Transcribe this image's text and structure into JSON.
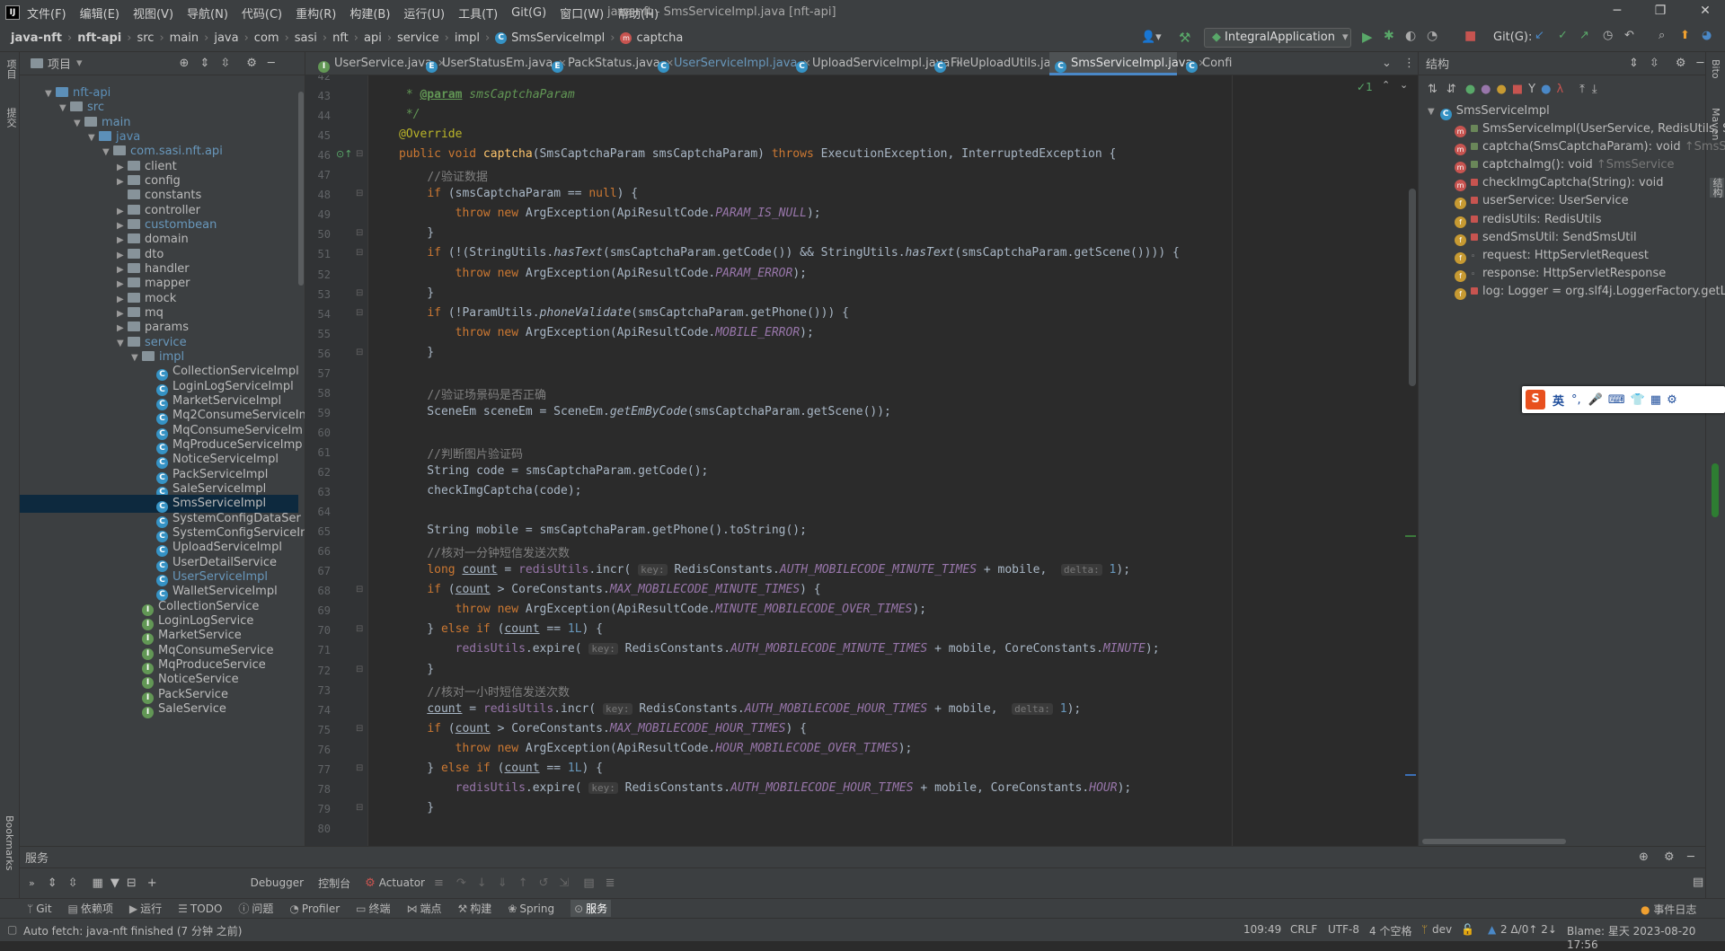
{
  "titlebar": {
    "menu": [
      "文件(F)",
      "编辑(E)",
      "视图(V)",
      "导航(N)",
      "代码(C)",
      "重构(R)",
      "构建(B)",
      "运行(U)",
      "工具(T)",
      "Git(G)",
      "窗口(W)",
      "帮助(H)"
    ],
    "window_title": "java-nft - SmsServiceImpl.java [nft-api]"
  },
  "navbar": {
    "crumbs": [
      "java-nft",
      "nft-api",
      "src",
      "main",
      "java",
      "com",
      "sasi",
      "nft",
      "api",
      "service",
      "impl",
      "SmsServiceImpl",
      "captcha"
    ],
    "run_config": "IntegralApplication",
    "git_label": "Git(G):"
  },
  "project": {
    "title": "项目",
    "items": [
      {
        "label": "nft-api",
        "kind": "module",
        "depth": 1,
        "expanded": true
      },
      {
        "label": "src",
        "kind": "folder",
        "depth": 2,
        "expanded": true
      },
      {
        "label": "main",
        "kind": "folder",
        "depth": 3,
        "expanded": true
      },
      {
        "label": "java",
        "kind": "folder-blue",
        "depth": 4,
        "expanded": true
      },
      {
        "label": "com.sasi.nft.api",
        "kind": "package",
        "depth": 5,
        "expanded": true
      },
      {
        "label": "client",
        "kind": "package",
        "depth": 6,
        "expanded": false
      },
      {
        "label": "config",
        "kind": "package",
        "depth": 6,
        "expanded": false
      },
      {
        "label": "constants",
        "kind": "package",
        "depth": 6,
        "expanded": null
      },
      {
        "label": "controller",
        "kind": "package",
        "depth": 6,
        "expanded": false
      },
      {
        "label": "custombean",
        "kind": "package",
        "depth": 6,
        "expanded": false
      },
      {
        "label": "domain",
        "kind": "package",
        "depth": 6,
        "expanded": false
      },
      {
        "label": "dto",
        "kind": "package",
        "depth": 6,
        "expanded": false
      },
      {
        "label": "handler",
        "kind": "package",
        "depth": 6,
        "expanded": false
      },
      {
        "label": "mapper",
        "kind": "package",
        "depth": 6,
        "expanded": false
      },
      {
        "label": "mock",
        "kind": "package",
        "depth": 6,
        "expanded": false
      },
      {
        "label": "mq",
        "kind": "package",
        "depth": 6,
        "expanded": false
      },
      {
        "label": "params",
        "kind": "package",
        "depth": 6,
        "expanded": false
      },
      {
        "label": "service",
        "kind": "package",
        "depth": 6,
        "expanded": true
      },
      {
        "label": "impl",
        "kind": "package",
        "depth": 7,
        "expanded": true
      },
      {
        "label": "CollectionServiceImpl",
        "kind": "class",
        "depth": 8
      },
      {
        "label": "LoginLogServiceImpl",
        "kind": "class",
        "depth": 8
      },
      {
        "label": "MarketServiceImpl",
        "kind": "class",
        "depth": 8
      },
      {
        "label": "Mq2ConsumeServiceIn",
        "kind": "class",
        "depth": 8
      },
      {
        "label": "MqConsumeServiceIm",
        "kind": "class",
        "depth": 8
      },
      {
        "label": "MqProduceServiceImp",
        "kind": "class",
        "depth": 8
      },
      {
        "label": "NoticeServiceImpl",
        "kind": "class",
        "depth": 8
      },
      {
        "label": "PackServiceImpl",
        "kind": "class",
        "depth": 8
      },
      {
        "label": "SaleServiceImpl",
        "kind": "class",
        "depth": 8
      },
      {
        "label": "SmsServiceImpl",
        "kind": "class",
        "depth": 8,
        "selected": true
      },
      {
        "label": "SystemConfigDataSer",
        "kind": "class",
        "depth": 8
      },
      {
        "label": "SystemConfigServiceIn",
        "kind": "class",
        "depth": 8
      },
      {
        "label": "UploadServiceImpl",
        "kind": "class",
        "depth": 8
      },
      {
        "label": "UserDetailService",
        "kind": "class",
        "depth": 8
      },
      {
        "label": "UserServiceImpl",
        "kind": "class",
        "depth": 8,
        "modified": true
      },
      {
        "label": "WalletServiceImpl",
        "kind": "class",
        "depth": 8
      },
      {
        "label": "CollectionService",
        "kind": "interface",
        "depth": 7
      },
      {
        "label": "LoginLogService",
        "kind": "interface",
        "depth": 7
      },
      {
        "label": "MarketService",
        "kind": "interface",
        "depth": 7
      },
      {
        "label": "MqConsumeService",
        "kind": "interface",
        "depth": 7
      },
      {
        "label": "MqProduceService",
        "kind": "interface",
        "depth": 7
      },
      {
        "label": "NoticeService",
        "kind": "interface",
        "depth": 7
      },
      {
        "label": "PackService",
        "kind": "interface",
        "depth": 7
      },
      {
        "label": "SaleService",
        "kind": "interface",
        "depth": 7
      }
    ]
  },
  "tabs": [
    {
      "label": "UserService.java",
      "kind": "interface"
    },
    {
      "label": "UserStatusEm.java",
      "kind": "enum"
    },
    {
      "label": "PackStatus.java",
      "kind": "enum"
    },
    {
      "label": "UserServiceImpl.java",
      "kind": "class",
      "modified": true
    },
    {
      "label": "UploadServiceImpl.java",
      "kind": "class"
    },
    {
      "label": "FileUploadUtils.java",
      "kind": "class"
    },
    {
      "label": "SmsServiceImpl.java",
      "kind": "class",
      "active": true
    },
    {
      "label": "Confi",
      "kind": "class"
    }
  ],
  "editor": {
    "inspection_count": "1",
    "lines": [
      {
        "n": "42",
        "html": "<span class=\"doc\"> *</span>"
      },
      {
        "n": "43",
        "html": "<span class=\"doc\"> * </span><span class=\"doctag\">@param</span><span class=\"doc\"> smsCaptchaParam</span>"
      },
      {
        "n": "44",
        "html": "<span class=\"doc\"> */</span>"
      },
      {
        "n": "45",
        "html": "<span class=\"an\">@Override</span>"
      },
      {
        "n": "46",
        "html": "<span class=\"kw\">public void </span><span class=\"fn\">captcha</span>(SmsCaptchaParam smsCaptchaParam) <span class=\"kw\">throws </span>ExecutionException, InterruptedException {"
      },
      {
        "n": "47",
        "html": "    <span class=\"cm\">//验证数据</span>"
      },
      {
        "n": "48",
        "html": "    <span class=\"kw\">if </span>(smsCaptchaParam == <span class=\"kw\">null</span>) {"
      },
      {
        "n": "49",
        "html": "        <span class=\"kw\">throw new </span>ArgException(ApiResultCode.<span class=\"st\">PARAM_IS_NULL</span>);"
      },
      {
        "n": "50",
        "html": "    }"
      },
      {
        "n": "51",
        "html": "    <span class=\"kw\">if </span>(!(StringUtils.<span class=\"it\">hasText</span>(smsCaptchaParam.getCode()) &amp;&amp; StringUtils.<span class=\"it\">hasText</span>(smsCaptchaParam.getScene()))) {"
      },
      {
        "n": "52",
        "html": "        <span class=\"kw\">throw new </span>ArgException(ApiResultCode.<span class=\"st\">PARAM_ERROR</span>);"
      },
      {
        "n": "53",
        "html": "    }"
      },
      {
        "n": "54",
        "html": "    <span class=\"kw\">if </span>(!ParamUtils.<span class=\"it\">phoneValidate</span>(smsCaptchaParam.getPhone())) {"
      },
      {
        "n": "55",
        "html": "        <span class=\"kw\">throw new </span>ArgException(ApiResultCode.<span class=\"st\">MOBILE_ERROR</span>);"
      },
      {
        "n": "56",
        "html": "    }"
      },
      {
        "n": "57",
        "html": ""
      },
      {
        "n": "58",
        "html": "    <span class=\"cm\">//验证场景码是否正确</span>"
      },
      {
        "n": "59",
        "html": "    SceneEm sceneEm = SceneEm.<span class=\"it\">getEmByCode</span>(smsCaptchaParam.getScene());"
      },
      {
        "n": "60",
        "html": ""
      },
      {
        "n": "61",
        "html": "    <span class=\"cm\">//判断图片验证码</span>"
      },
      {
        "n": "62",
        "html": "    String code = smsCaptchaParam.getCode();"
      },
      {
        "n": "63",
        "html": "    checkImgCaptcha(code);"
      },
      {
        "n": "64",
        "html": ""
      },
      {
        "n": "65",
        "html": "    String mobile = smsCaptchaParam.getPhone().toString();"
      },
      {
        "n": "66",
        "html": "    <span class=\"cm\">//核对一分钟短信发送次数</span>"
      },
      {
        "n": "67",
        "html": "    <span class=\"kw\">long </span><span class=\"ul\">count</span> = <span class=\"st\" style=\"font-style:normal\">redisUtils</span>.incr( <span class=\"hint\">key:</span> RedisConstants.<span class=\"st\">AUTH_MOBILECODE_MINUTE_TIMES</span> + mobile,  <span class=\"hint\">delta:</span> <span class=\"nm\">1</span>);"
      },
      {
        "n": "68",
        "html": "    <span class=\"kw\">if </span>(<span class=\"ul\">count</span> &gt; CoreConstants.<span class=\"st\">MAX_MOBILECODE_MINUTE_TIMES</span>) {"
      },
      {
        "n": "69",
        "html": "        <span class=\"kw\">throw new </span>ArgException(ApiResultCode.<span class=\"st\">MINUTE_MOBILECODE_OVER_TIMES</span>);"
      },
      {
        "n": "70",
        "html": "    } <span class=\"kw\">else if </span>(<span class=\"ul\">count</span> == <span class=\"nm\">1L</span>) {"
      },
      {
        "n": "71",
        "html": "        <span class=\"st\" style=\"font-style:normal\">redisUtils</span>.expire( <span class=\"hint\">key:</span> RedisConstants.<span class=\"st\">AUTH_MOBILECODE_MINUTE_TIMES</span> + mobile, CoreConstants.<span class=\"st\">MINUTE</span>);"
      },
      {
        "n": "72",
        "html": "    }"
      },
      {
        "n": "73",
        "html": "    <span class=\"cm\">//核对一小时短信发送次数</span>"
      },
      {
        "n": "74",
        "html": "    <span class=\"ul\">count</span> = <span class=\"st\" style=\"font-style:normal\">redisUtils</span>.incr( <span class=\"hint\">key:</span> RedisConstants.<span class=\"st\">AUTH_MOBILECODE_HOUR_TIMES</span> + mobile,  <span class=\"hint\">delta:</span> <span class=\"nm\">1</span>);"
      },
      {
        "n": "75",
        "html": "    <span class=\"kw\">if </span>(<span class=\"ul\">count</span> &gt; CoreConstants.<span class=\"st\">MAX_MOBILECODE_HOUR_TIMES</span>) {"
      },
      {
        "n": "76",
        "html": "        <span class=\"kw\">throw new </span>ArgException(ApiResultCode.<span class=\"st\">HOUR_MOBILECODE_OVER_TIMES</span>);"
      },
      {
        "n": "77",
        "html": "    } <span class=\"kw\">else if </span>(<span class=\"ul\">count</span> == <span class=\"nm\">1L</span>) {"
      },
      {
        "n": "78",
        "html": "        <span class=\"st\" style=\"font-style:normal\">redisUtils</span>.expire( <span class=\"hint\">key:</span> RedisConstants.<span class=\"st\">AUTH_MOBILECODE_HOUR_TIMES</span> + mobile, CoreConstants.<span class=\"st\">HOUR</span>);"
      },
      {
        "n": "79",
        "html": "    }"
      },
      {
        "n": "80",
        "html": ""
      }
    ]
  },
  "structure": {
    "title": "结构",
    "root": "SmsServiceImpl",
    "items": [
      {
        "label": "SmsServiceImpl(UserService, RedisUtils, Se",
        "kind": "method",
        "access": "public",
        "suffix": ""
      },
      {
        "label": "captcha(SmsCaptchaParam): void",
        "kind": "method",
        "access": "public",
        "suffix": "↑SmsSe"
      },
      {
        "label": "captchaImg(): void",
        "kind": "method",
        "access": "public",
        "suffix": "↑SmsService"
      },
      {
        "label": "checkImgCaptcha(String): void",
        "kind": "method",
        "access": "private",
        "suffix": ""
      },
      {
        "label": "userService: UserService",
        "kind": "field",
        "access": "private",
        "suffix": ""
      },
      {
        "label": "redisUtils: RedisUtils",
        "kind": "field",
        "access": "private",
        "suffix": ""
      },
      {
        "label": "sendSmsUtil: SendSmsUtil",
        "kind": "field",
        "access": "private",
        "suffix": ""
      },
      {
        "label": "request: HttpServletRequest",
        "kind": "field",
        "access": "package",
        "suffix": ""
      },
      {
        "label": "response: HttpServletResponse",
        "kind": "field",
        "access": "package",
        "suffix": ""
      },
      {
        "label": "log: Logger = org.slf4j.LoggerFactory.getL",
        "kind": "field",
        "access": "private",
        "suffix": ""
      }
    ]
  },
  "ime": {
    "lang": "英"
  },
  "services": {
    "title": "服务",
    "tabs": [
      "Debugger",
      "控制台",
      "Actuator"
    ]
  },
  "toolwindows": [
    "Git",
    "依赖项",
    "运行",
    "TODO",
    "问题",
    "Profiler",
    "终端",
    "端点",
    "构建",
    "Spring",
    "服务"
  ],
  "toolwindows_right": "事件日志",
  "statusbar": {
    "message": "Auto fetch: java-nft finished (7 分钟 之前)",
    "position": "109:49",
    "line_sep": "CRLF",
    "encoding": "UTF-8",
    "indent": "4 个空格",
    "branch": "dev",
    "changes": "2 Δ/0↑ 2↓",
    "blame": "Blame: 星天 2023-08-20 17:56"
  },
  "side_labels": {
    "left_top": "项目",
    "left_commit": "提交",
    "left_bottom": "Bookmarks",
    "right_bito": "Bito",
    "right_maven": "Maven",
    "right_structure": "结构"
  }
}
